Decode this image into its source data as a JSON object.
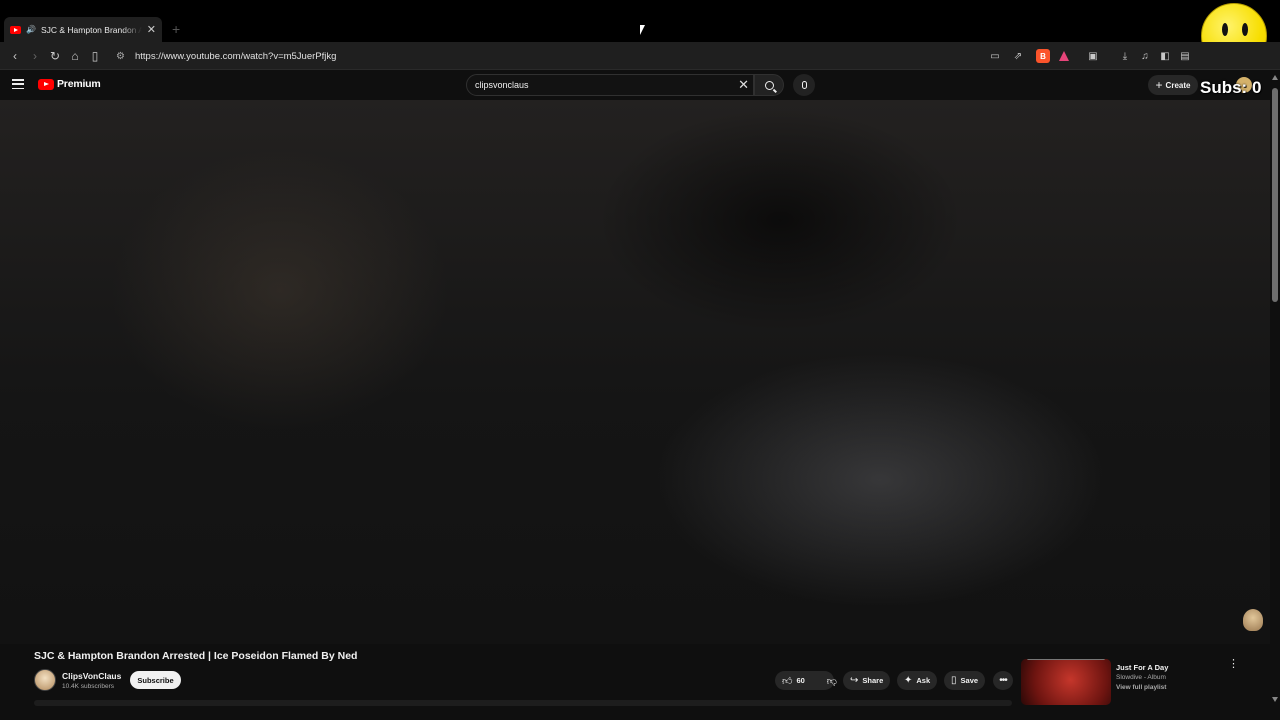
{
  "browser": {
    "tab_title": "SJC & Hampton Brandon Arre",
    "url": "https://www.youtube.com/watch?v=m5JuerPfjkg"
  },
  "header": {
    "logo_text": "Premium",
    "search_value": "clipsvonclaus",
    "create_label": "Create"
  },
  "overlay": {
    "subs_text": "Subs: 0"
  },
  "video": {
    "title": "SJC & Hampton Brandon Arrested | Ice Poseidon Flamed By Ned",
    "channel_name": "ClipsVonClaus",
    "channel_subs": "10.4K subscribers",
    "subscribe_label": "Subscribe",
    "like_count": "60",
    "share_label": "Share",
    "ask_label": "Ask",
    "save_label": "Save"
  },
  "recommendation": {
    "title": "Just For A Day",
    "meta": "Slowdive - Album",
    "link": "View full playlist"
  },
  "colors": {
    "brand": "#ff0000",
    "background": "#0f0f0f"
  }
}
